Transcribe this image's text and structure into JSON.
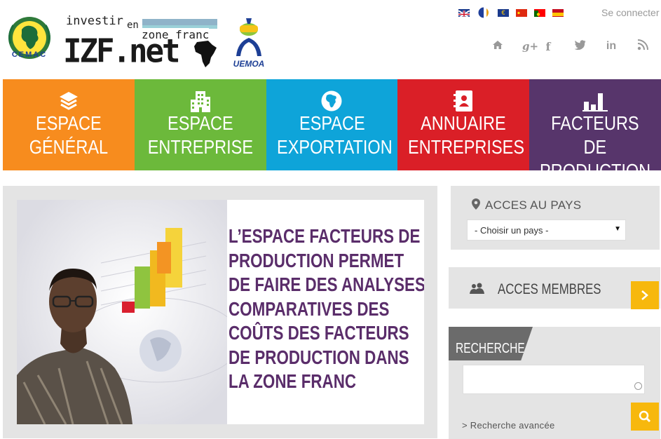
{
  "header": {
    "cemac_text": "CEMAC",
    "izf": {
      "line1": "investir",
      "line2": "en",
      "line3": "zone franc",
      "main": "IZF.net"
    },
    "uemoa_text": "UEMOA",
    "login_label": "Se connecter",
    "flags": [
      "en",
      "fr",
      "eu",
      "cn",
      "pt",
      "es"
    ],
    "social_icons": [
      "home-icon",
      "google-plus-icon",
      "facebook-icon",
      "twitter-icon",
      "linkedin-icon",
      "rss-icon"
    ],
    "social_glyphs": {
      "gplus": "g+",
      "facebook": "f",
      "linkedin": "in"
    }
  },
  "nav": {
    "tiles": [
      {
        "line1": "ESPACE",
        "line2": "GÉNÉRAL",
        "icon": "layers-icon",
        "color": "#f78c1e"
      },
      {
        "line1": "ESPACE",
        "line2": "ENTREPRISE",
        "icon": "buildings-icon",
        "color": "#6cb93b"
      },
      {
        "line1": "ESPACE",
        "line2": "EXPORTATION",
        "icon": "globe-icon",
        "color": "#0ea4d9"
      },
      {
        "line1": "ANNUAIRE",
        "line2": "ENTREPRISES",
        "icon": "address-book-icon",
        "color": "#da1f27"
      },
      {
        "line1": "FACTEURS DE",
        "line2": "PRODUCTION",
        "icon": "bar-chart-icon",
        "color": "#57356b"
      }
    ]
  },
  "banner": {
    "lines": [
      "L’ESPACE FACTEURS DE",
      "PRODUCTION PERMET",
      "DE FAIRE DES ANALYSES",
      "COMPARATIVES DES",
      "COÛTS DES FACTEURS",
      "DE PRODUCTION DANS",
      "LA ZONE FRANC"
    ]
  },
  "sidebar": {
    "country": {
      "title": "ACCES AU PAYS",
      "select_value": "- Choisir un pays -"
    },
    "members": {
      "title": "ACCES MEMBRES"
    },
    "search": {
      "title": "RECHERCHE",
      "input_value": "",
      "advanced_label": "> Recherche avancée"
    }
  },
  "colors": {
    "orange": "#f78c1e",
    "green": "#6cb93b",
    "blue": "#0ea4d9",
    "red": "#da1f27",
    "purple": "#57356b",
    "yellow": "#f7b80d",
    "panel_grey": "#e4e4e4"
  }
}
